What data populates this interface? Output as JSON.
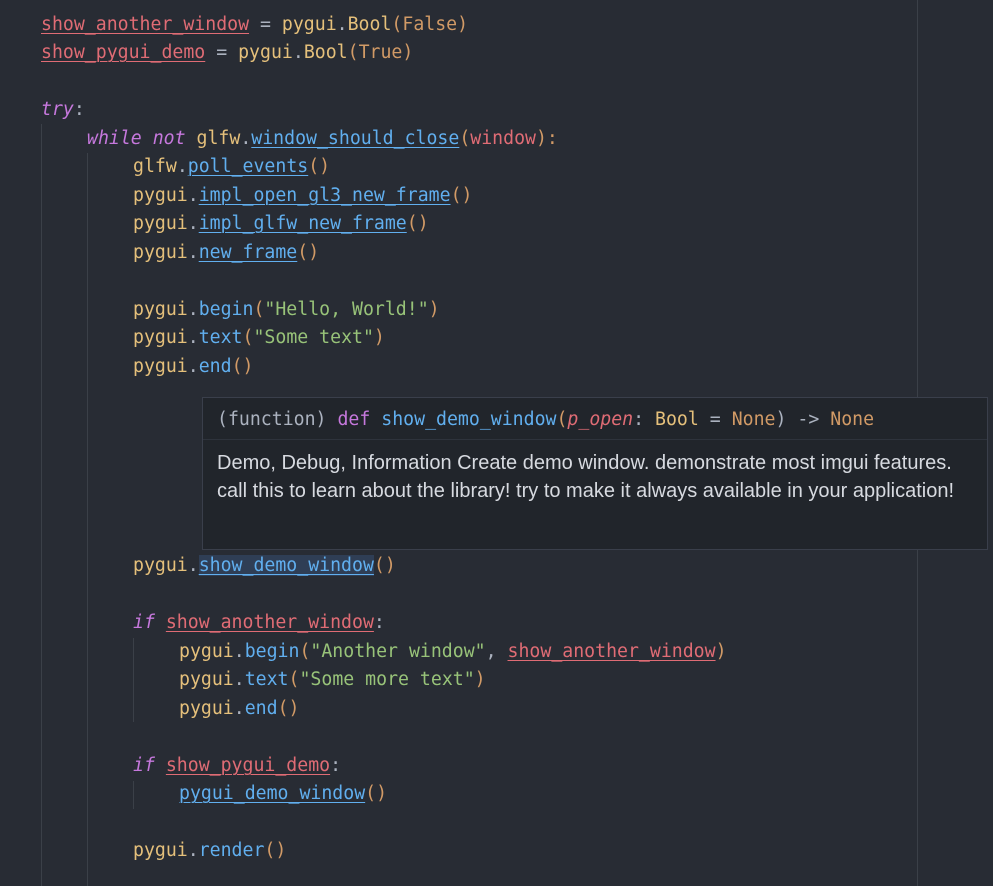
{
  "code": {
    "l1": {
      "a": "show_another_window",
      "b": " = ",
      "c": "pygui",
      "d": ".",
      "e": "Bool",
      "f": "(",
      "g": "False",
      "h": ")"
    },
    "l2": {
      "a": "show_pygui_demo",
      "b": " = ",
      "c": "pygui",
      "d": ".",
      "e": "Bool",
      "f": "(",
      "g": "True",
      "h": ")"
    },
    "l4": {
      "a": "try",
      "b": ":"
    },
    "l5": {
      "a": "while",
      "b": " ",
      "c": "not",
      "d": " ",
      "e": "glfw",
      "f": ".",
      "g": "window_should_close",
      "h": "(",
      "i": "window",
      "j": "):"
    },
    "l6": {
      "a": "glfw",
      "b": ".",
      "c": "poll_events",
      "d": "()"
    },
    "l7": {
      "a": "pygui",
      "b": ".",
      "c": "impl_open_gl3_new_frame",
      "d": "()"
    },
    "l8": {
      "a": "pygui",
      "b": ".",
      "c": "impl_glfw_new_frame",
      "d": "()"
    },
    "l9": {
      "a": "pygui",
      "b": ".",
      "c": "new_frame",
      "d": "()"
    },
    "l11": {
      "a": "pygui",
      "b": ".",
      "c": "begin",
      "d": "(",
      "e": "\"Hello, World!\"",
      "f": ")"
    },
    "l12": {
      "a": "pygui",
      "b": ".",
      "c": "text",
      "d": "(",
      "e": "\"Some text\"",
      "f": ")"
    },
    "l13": {
      "a": "pygui",
      "b": ".",
      "c": "end",
      "d": "()"
    },
    "l18": {
      "a": "pygui",
      "b": ".",
      "c": "show_demo_window",
      "d": "()"
    },
    "l20": {
      "a": "if",
      "b": " ",
      "c": "show_another_window",
      "d": ":"
    },
    "l21": {
      "a": "pygui",
      "b": ".",
      "c": "begin",
      "d": "(",
      "e": "\"Another window\"",
      "f": ", ",
      "g": "show_another_window",
      "h": ")"
    },
    "l22": {
      "a": "pygui",
      "b": ".",
      "c": "text",
      "d": "(",
      "e": "\"Some more text\"",
      "f": ")"
    },
    "l23": {
      "a": "pygui",
      "b": ".",
      "c": "end",
      "d": "()"
    },
    "l25": {
      "a": "if",
      "b": " ",
      "c": "show_pygui_demo",
      "d": ":"
    },
    "l26": {
      "a": "pygui_demo_window",
      "b": "()"
    },
    "l28": {
      "a": "pygui",
      "b": ".",
      "c": "render",
      "d": "()"
    }
  },
  "hover": {
    "signature": {
      "a": "(function) ",
      "b": "def",
      "c": " ",
      "d": "show_demo_window",
      "e": "(",
      "f": "p_open",
      "g": ": ",
      "h": "Bool",
      "i": " = ",
      "j": "None",
      "k": ") -> ",
      "l": "None"
    },
    "doc": "Demo, Debug, Information Create demo window. demonstrate most imgui features. call this to learn about the library! try to make it always available in your application!"
  },
  "colors": {
    "background": "#282c34",
    "variable": "#e06c75",
    "module": "#e5c07b",
    "function": "#61afef",
    "string": "#98c379",
    "keyword": "#c678dd",
    "constant": "#d19a66",
    "hover_background": "#21252b"
  }
}
